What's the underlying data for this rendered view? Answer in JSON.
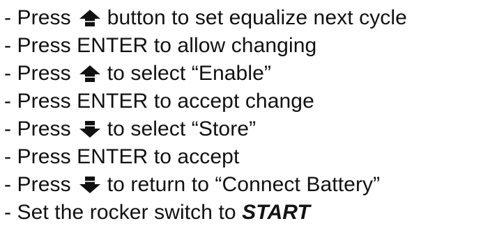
{
  "steps": [
    {
      "before": "- Press",
      "icon": "up-arrow-icon",
      "after": "button to set equalize next cycle"
    },
    {
      "text": "- Press ENTER to allow changing"
    },
    {
      "before": "- Press",
      "icon": "up-arrow-icon",
      "after": "to select “Enable”"
    },
    {
      "text": "- Press ENTER to accept change"
    },
    {
      "before": "- Press",
      "icon": "down-arrow-icon",
      "after": "to select “Store”"
    },
    {
      "text": "- Press ENTER to accept"
    },
    {
      "before": "- Press",
      "icon": "down-arrow-icon",
      "after": "to return to “Connect Battery”"
    },
    {
      "text": "- Set the rocker switch to",
      "emphasis": "START"
    }
  ]
}
